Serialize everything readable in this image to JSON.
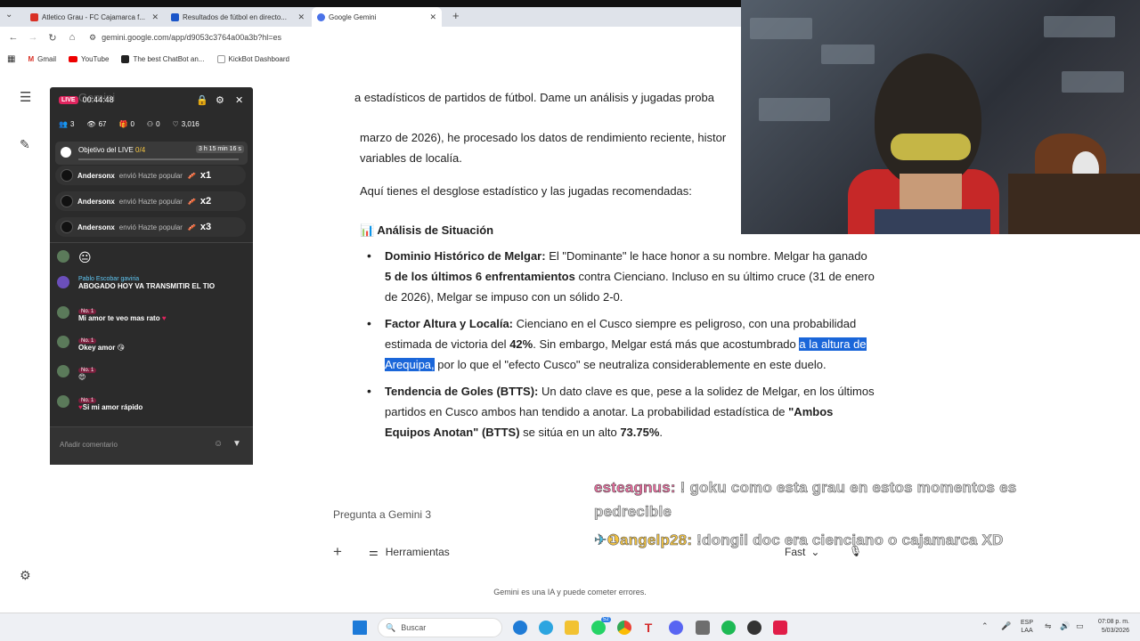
{
  "browser": {
    "tabs": [
      {
        "title": "Atletico Grau - FC Cajamarca f...",
        "color": "#d93025"
      },
      {
        "title": "Resultados de fútbol en directo...",
        "color": "#1a55c9"
      },
      {
        "title": "Google Gemini",
        "color": "#4a72e8"
      }
    ],
    "url": "gemini.google.com/app/d9053c3764a00a3b?hl=es",
    "bookmarks": [
      "Gmail",
      "YouTube",
      "The best ChatBot an...",
      "KickBot Dashboard"
    ]
  },
  "gemini": {
    "line1": "a estadísticos de partidos de fútbol. Dame un análisis y jugadas proba",
    "line2": "marzo de 2026), he procesado los datos de rendimiento reciente, histor",
    "line3": "variables de localía.",
    "intro": "Aquí tienes el desglose estadístico y las jugadas recomendadas:",
    "section_icon": "📊",
    "section_title": "Análisis de Situación",
    "b1_head": "Dominio Histórico de Melgar:",
    "b1_t1": " El \"Dominante\" le hace honor a su nombre. Melgar ha ganado ",
    "b1_bold": "5 de los últimos 6 enfrentamientos",
    "b1_t2": " contra Cienciano. Incluso en su último cruce (31 de enero de 2026), Melgar se impuso con un sólido 2-0.",
    "b2_head": "Factor Altura y Localía:",
    "b2_t1": " Cienciano en el Cusco siempre es peligroso, con una probabilidad estimada de victoria del ",
    "b2_bold": "42%",
    "b2_t2": ". Sin embargo, Melgar está más que acostumbrado ",
    "b2_hl": "a la altura de Arequipa,",
    "b2_t3": " por lo que el \"efecto Cusco\" se neutraliza considerablemente en este duelo.",
    "b3_head": "Tendencia de Goles (BTTS):",
    "b3_t1": " Un dato clave es que, pese a la solidez de Melgar, en los últimos partidos en Cusco ambos han tendido a anotar. La probabilidad estadística de ",
    "b3_bold": "\"Ambos Equipos Anotan\" (BTTS)",
    "b3_t2": " se sitúa en un alto ",
    "b3_bold2": "73.75%",
    "b3_t3": ".",
    "prompt_placeholder": "Pregunta a Gemini 3",
    "tools_label": "Herramientas",
    "model_label": "Fast",
    "disclaimer": "Gemini es una IA y puede cometer errores."
  },
  "live": {
    "header_title": "Gemini",
    "live_badge": "LIVE",
    "timer": "00:44:48",
    "stats": [
      "3",
      "67",
      "0",
      "0",
      "3,016"
    ],
    "goal_label": "Objetivo del LIVE",
    "goal_progress": "0/4",
    "goal_time": "3 h 15 min 16 s",
    "gifts": [
      {
        "user": "Andersonx",
        "text": "envió Hazte popular",
        "count": "x1"
      },
      {
        "user": "Andersonx",
        "text": "envió Hazte popular",
        "count": "x2"
      },
      {
        "user": "Andersonx",
        "text": "envió Hazte popular",
        "count": "x3"
      }
    ],
    "badge_text": "No. 1",
    "chat": [
      {
        "name": "Pablo Escobar gaviria",
        "text": "ABOGADO HOY VA TRANSMITIR EL TIO"
      },
      {
        "name": "",
        "text": "Mi amor te veo mas rato"
      },
      {
        "name": "",
        "text": "Okey amor"
      },
      {
        "name": "",
        "text": ""
      },
      {
        "name": "",
        "text": "Si mi amor rápido"
      }
    ],
    "comment_placeholder": "Añadir comentario"
  },
  "overlay": {
    "c1_user": "esteagnus:",
    "c1_text": " ! goku como esta grau en estos momentos es pedrecible",
    "c2_user": "angelp28:",
    "c2_text": " !dongil doc era cienciano o cajamarca XD"
  },
  "taskbar": {
    "search": "Buscar",
    "lang1": "ESP",
    "lang2": "LAA",
    "time": "07:08 p. m.",
    "date": "5/03/2026",
    "whatsapp_badge": "52"
  }
}
